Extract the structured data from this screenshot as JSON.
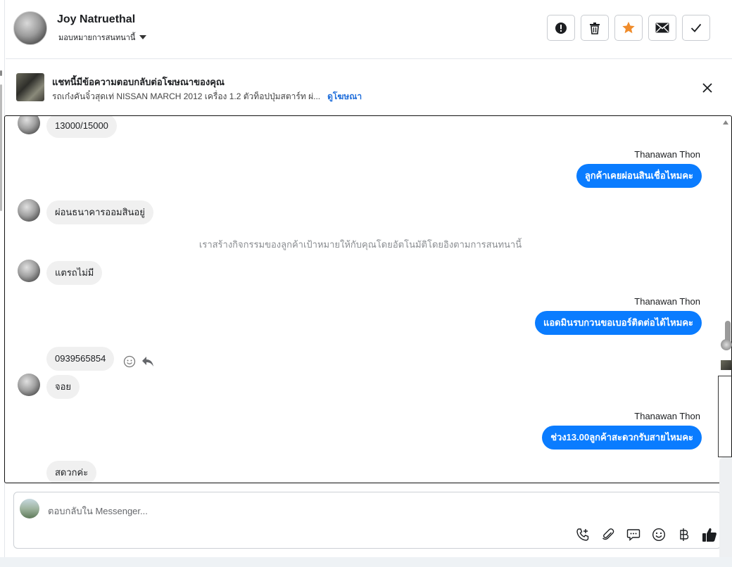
{
  "header": {
    "contact_name": "Joy Natruethal",
    "assign_label": "มอบหมายการสนทนานี้"
  },
  "banner": {
    "title": "แชทนี้มีข้อความตอบกลับต่อโฆษณาของคุณ",
    "subtitle": "รถเก๋งคันจิ๋วสุดเท่ NISSAN MARCH 2012 เครื่อง 1.2 ตัวท็อปปุ่มสตาร์ท ผ่...",
    "view_ad_link": "ดูโฆษณา"
  },
  "thread": {
    "messages": [
      {
        "dir": "in",
        "text": "13000/15000"
      },
      {
        "dir": "out",
        "sender": "Thanawan Thon",
        "text": "ลูกค้าเคยผ่อนสินเชื่อไหมคะ"
      },
      {
        "dir": "in",
        "text": "ผ่อนธนาคารออมสินอยู่"
      },
      {
        "dir": "system",
        "text": "เราสร้างกิจกรรมของลูกค้าเป้าหมายให้กับคุณโดยอัตโนมัติโดยอิงตามการสนทนานี้"
      },
      {
        "dir": "in",
        "text": "แตรถไม่มี"
      },
      {
        "dir": "out",
        "sender": "Thanawan Thon",
        "text": "แอดมินรบกวนขอเบอร์ติดต่อได้ไหมคะ"
      },
      {
        "dir": "in",
        "text": "0939565854"
      },
      {
        "dir": "in",
        "text": "จอย"
      },
      {
        "dir": "out",
        "sender": "Thanawan Thon",
        "text": "ช่วง13.00ลูกค้าสะดวกรับสายไหมคะ"
      },
      {
        "dir": "in",
        "text": "สดวกค่ะ"
      }
    ]
  },
  "composer": {
    "placeholder": "ตอบกลับใน Messenger..."
  },
  "colors": {
    "outgoing_bubble": "#0a7cff",
    "incoming_bubble": "#f0f0f0",
    "star_accent": "#f08c2b"
  },
  "icons": {
    "toolbar": [
      "alert-icon",
      "trash-icon",
      "star-icon",
      "mail-icon",
      "check-icon"
    ],
    "composer": [
      "add-call-icon",
      "paperclip-icon",
      "chat-bubble-icon",
      "emoji-icon",
      "baht-icon",
      "thumbs-up-icon"
    ]
  }
}
